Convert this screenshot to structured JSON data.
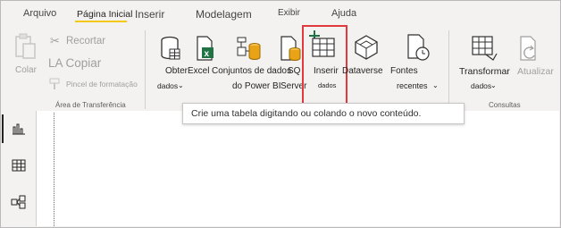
{
  "tabs": [
    {
      "label": "Arquivo"
    },
    {
      "label": "Página Inicial"
    },
    {
      "label": "Inserir"
    },
    {
      "label": "Modelagem"
    },
    {
      "label": "Exibir"
    },
    {
      "label": "Ajuda"
    }
  ],
  "clipboard": {
    "paste_label": "Colar",
    "cut_label": "Recortar",
    "copy_label": "LA Copiar",
    "format_painter_label": "Pincel de formatação",
    "group_label": "Área de Transferência"
  },
  "data_group": {
    "get_data_line1": "Obter",
    "get_data_line2": "dados",
    "excel_label": "Excel",
    "datasets_line1": "Conjuntos de dados",
    "datasets_line2": "do Power BI",
    "sql_line1": "SQ",
    "sql_line2": "Server",
    "enter_data_line1": "Inserir",
    "enter_data_line2": "dados",
    "dataverse_label": "Dataverse",
    "recent_line1": "Fontes",
    "recent_line2": "recentes"
  },
  "queries": {
    "transform_line1": "Transformar",
    "transform_line2": "dados",
    "refresh_label": "Atualizar",
    "group_label": "Consultas"
  },
  "tooltip": {
    "text": "Crie uma tabela digitando ou colando o novo conteúdo."
  },
  "rail": {
    "items": [
      "report-view-icon",
      "data-view-icon",
      "model-view-icon"
    ]
  },
  "colors": {
    "accent_underline": "#f2c811",
    "highlight_border": "#e0393e",
    "excel_green": "#217346",
    "database_gold": "#e8a317"
  }
}
